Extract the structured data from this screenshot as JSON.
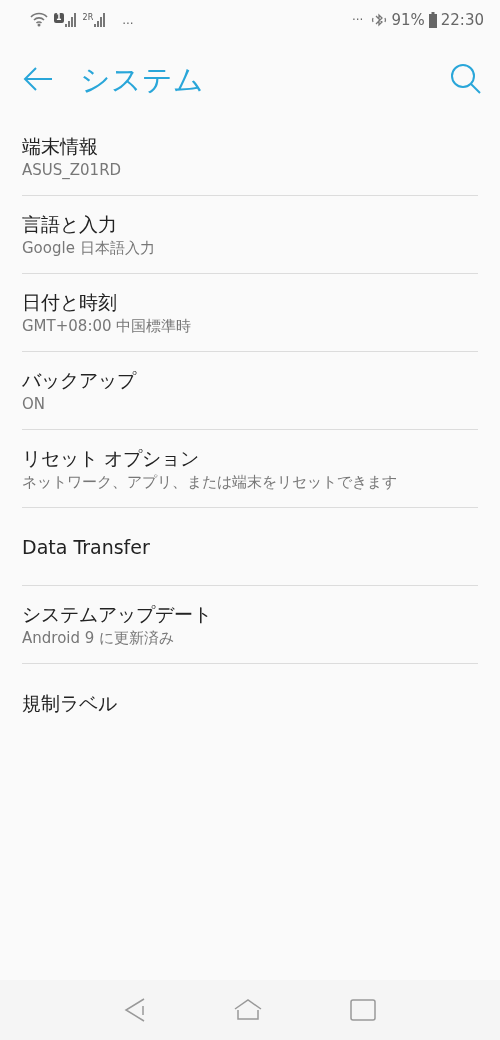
{
  "status_bar": {
    "sim1_label": "1",
    "sim2_label": "2R",
    "left_more": "...",
    "right_more": "···",
    "battery": "91%",
    "time": "22:30"
  },
  "app_bar": {
    "title": "システム"
  },
  "items": [
    {
      "title": "端末情報",
      "subtitle": "ASUS_Z01RD"
    },
    {
      "title": "言語と入力",
      "subtitle": "Google 日本語入力"
    },
    {
      "title": "日付と時刻",
      "subtitle": "GMT+08:00 中国標準時"
    },
    {
      "title": "バックアップ",
      "subtitle": "ON"
    },
    {
      "title": "リセット オプション",
      "subtitle": "ネットワーク、アプリ、または端末をリセットできます"
    },
    {
      "title": "Data Transfer"
    },
    {
      "title": "システムアップデート",
      "subtitle": "Android 9 に更新済み"
    },
    {
      "title": "規制ラベル"
    }
  ]
}
